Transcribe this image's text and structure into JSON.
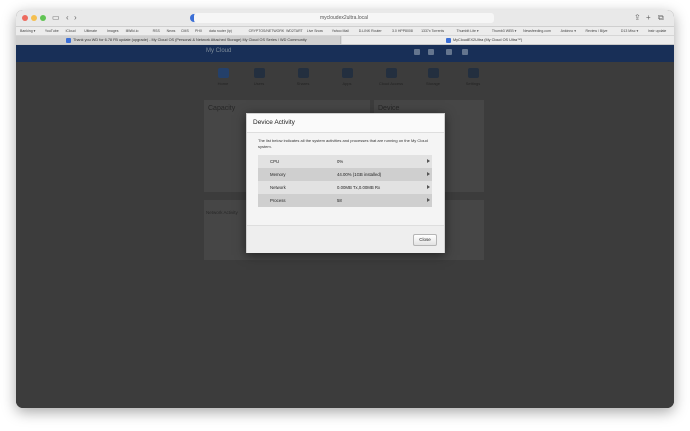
{
  "browser": {
    "address": "mycloudex2ultra.local",
    "bookmarks": [
      "Banking ▾",
      "YouTube",
      "iCloud",
      "Ultimate",
      "Images",
      "IllWiki.io",
      "RSS",
      "News",
      "CMS",
      "PHX",
      "data router (ip)",
      "CRYPTOS/NETWORK",
      "WD2TART",
      "Live Snow",
      "Yahoo Mail",
      "D-LINK Router",
      "3.0 HPP8008",
      "1337x Torrents",
      "ThumbIt Lite ▾",
      "Thumb3 WEB ▾",
      "Newsfeeding.com",
      "Ankinno ▾",
      "Review / Bijve",
      "D13 Misc ▾",
      "Instr update",
      "Insulpet/Probase"
    ],
    "tabs": [
      "Thank you WD for 6.78 FB update (upgrade) - My Cloud OS (Personal & Network Attached Storage) My Cloud OS Series / WD Community",
      "MyCloudEX2Ultra (My Cloud OS Ultra™)"
    ]
  },
  "app": {
    "logo": "My Cloud",
    "nav": [
      "Home",
      "Users",
      "Shares",
      "Apps",
      "Cloud Access",
      "Storage",
      "Settings"
    ],
    "panels": {
      "capacity": "Capacity",
      "device": "Device",
      "network_activity": "Network Activity"
    }
  },
  "modal": {
    "title": "Device Activity",
    "description": "The list below indicates all the system activities and processes that are running on the My Cloud system.",
    "rows": [
      {
        "label": "CPU",
        "value": "0%"
      },
      {
        "label": "Memory",
        "value": "44.00% (1GB installed)"
      },
      {
        "label": "Network",
        "value": "0.00MB Tx,0.00MB Rx"
      },
      {
        "label": "Process",
        "value": "58"
      }
    ],
    "close_label": "Close"
  }
}
